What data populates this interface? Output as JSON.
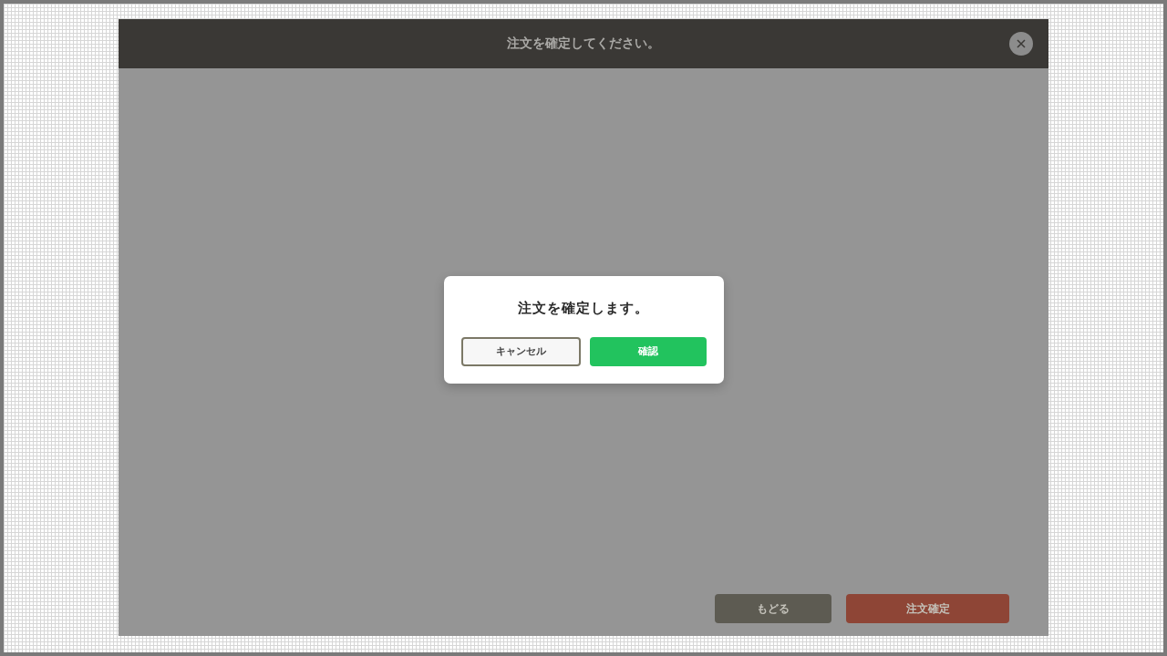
{
  "window": {
    "title": "注文を確定してください。"
  },
  "dialog": {
    "message": "注文を確定します。",
    "buttons": [
      {
        "label": "キャンセル",
        "kind": "secondary"
      },
      {
        "label": "確認",
        "kind": "primary"
      }
    ]
  },
  "footer": {
    "buttons": [
      {
        "label": "もどる",
        "kind": "back"
      },
      {
        "label": "注文確定",
        "kind": "confirm"
      }
    ]
  }
}
